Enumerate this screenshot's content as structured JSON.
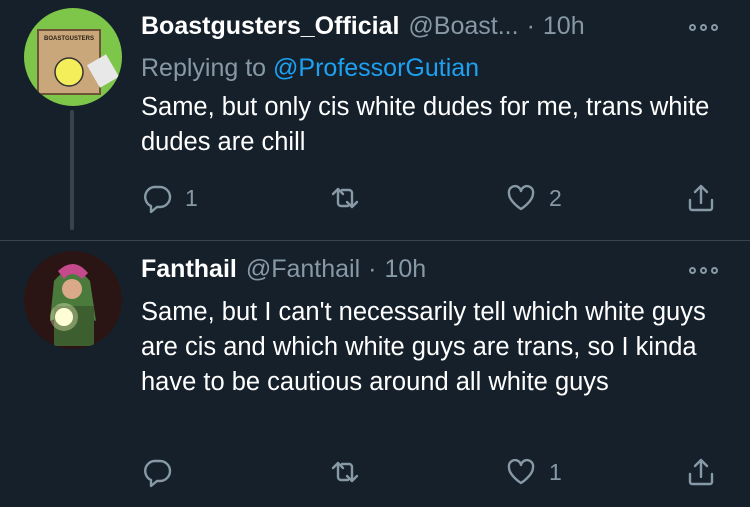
{
  "tweets": [
    {
      "name": "Boastgusters_Official",
      "handle": "@Boast...",
      "separator": "·",
      "time": "10h",
      "reply_prefix": "Replying to",
      "reply_mention": "@ProfessorGutian",
      "avatar_sign_text": "BOASTGUSTERS",
      "text": "Same, but only cis white dudes for me, trans white dudes are chill",
      "reply_count": "1",
      "retweet_count": "",
      "like_count": "2"
    },
    {
      "name": "Fanthail",
      "handle": "@Fanthail",
      "separator": "·",
      "time": "10h",
      "text": "Same, but I can't necessarily tell which white guys are cis and which white guys are trans, so I kinda have to be cautious around all white guys",
      "reply_count": "",
      "retweet_count": "",
      "like_count": "1"
    }
  ],
  "icons": {
    "reply": "reply-icon",
    "retweet": "retweet-icon",
    "like": "heart-icon",
    "share": "share-icon",
    "more": "more-icon"
  },
  "colors": {
    "background": "#15202b",
    "secondary_text": "#8899a6",
    "link": "#1da1f2",
    "divider": "#38444d"
  }
}
